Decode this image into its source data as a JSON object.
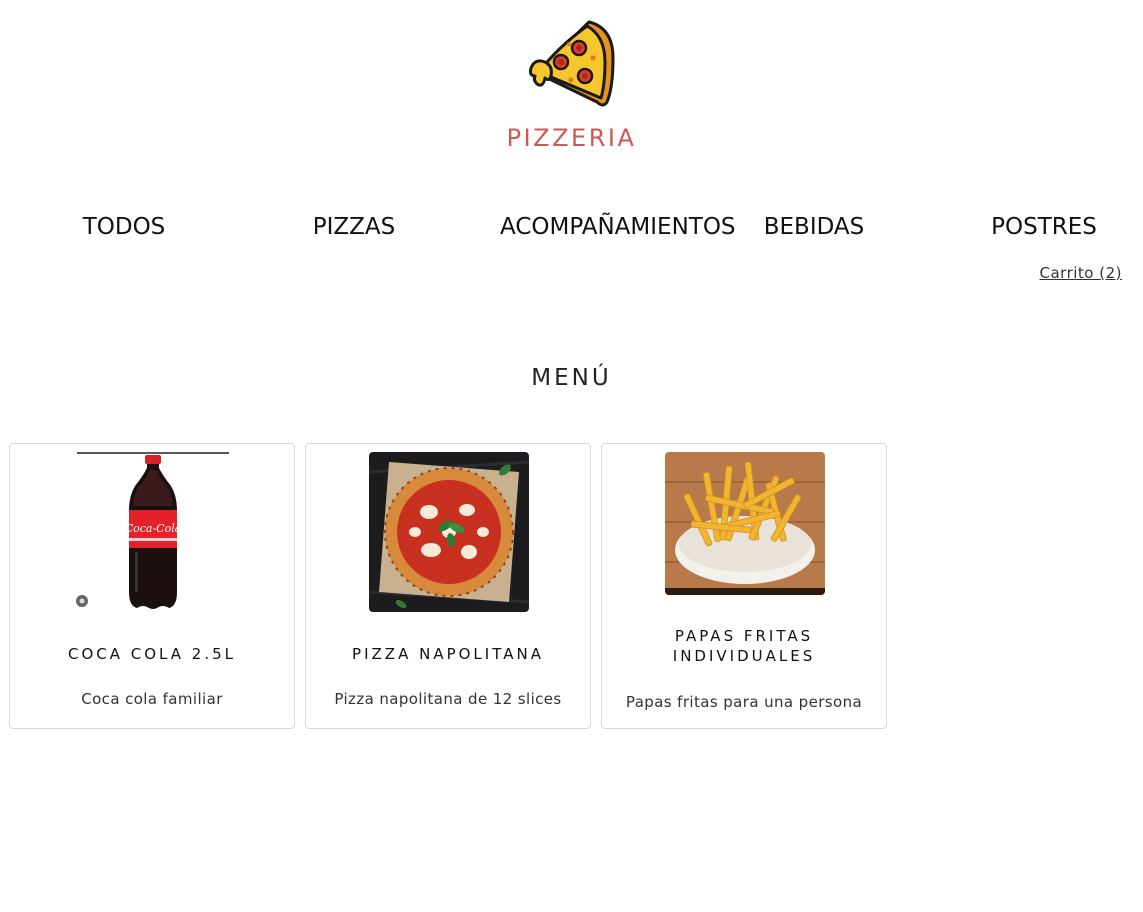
{
  "brand": {
    "name": "PIZZERIA",
    "logo_icon": "pizza-slice-icon",
    "color": "#cd5a52"
  },
  "nav": {
    "items": [
      {
        "label": "TODOS"
      },
      {
        "label": "PIZZAS"
      },
      {
        "label": "ACOMPAÑAMIENTOS"
      },
      {
        "label": "BEBIDAS"
      },
      {
        "label": "POSTRES"
      }
    ],
    "cart_label": "Carrito (2)"
  },
  "menu": {
    "title": "MENÚ",
    "products": [
      {
        "name": "COCA COLA 2.5L",
        "description": "Coca cola familiar",
        "image_icon": "cola-bottle-image"
      },
      {
        "name": "PIZZA NAPOLITANA",
        "description": "Pizza napolitana de 12 slices",
        "image_icon": "pizza-image"
      },
      {
        "name": "PAPAS FRITAS INDIVIDUALES",
        "description": "Papas fritas para una persona",
        "image_icon": "french-fries-image"
      }
    ]
  }
}
